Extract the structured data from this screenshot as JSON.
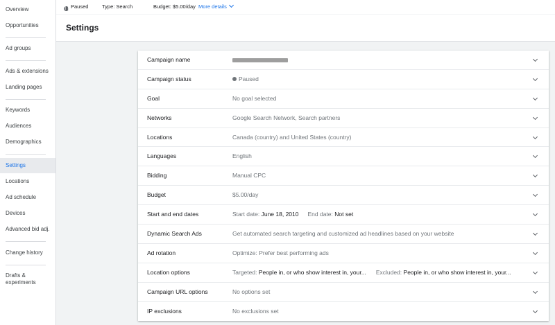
{
  "sidebar": {
    "items": [
      {
        "label": "Overview"
      },
      {
        "label": "Opportunities"
      },
      {
        "label": "Ad groups"
      },
      {
        "label": "Ads & extensions"
      },
      {
        "label": "Landing pages"
      },
      {
        "label": "Keywords"
      },
      {
        "label": "Audiences"
      },
      {
        "label": "Demographics"
      },
      {
        "label": "Settings"
      },
      {
        "label": "Locations"
      },
      {
        "label": "Ad schedule"
      },
      {
        "label": "Devices"
      },
      {
        "label": "Advanced bid adj."
      },
      {
        "label": "Change history"
      },
      {
        "label": "Drafts & experiments"
      }
    ],
    "active_item": "Settings"
  },
  "status_bar": {
    "status": "Paused",
    "type": "Type: Search",
    "budget": "Budget: $5.00/day",
    "more_details": "More details"
  },
  "header": {
    "title": "Settings"
  },
  "settings": {
    "rows": [
      {
        "label": "Campaign name",
        "value": ""
      },
      {
        "label": "Campaign status",
        "value": "Paused"
      },
      {
        "label": "Goal",
        "value": "No goal selected"
      },
      {
        "label": "Networks",
        "value": "Google Search Network, Search partners"
      },
      {
        "label": "Locations",
        "value": "Canada (country) and United States (country)"
      },
      {
        "label": "Languages",
        "value": "English"
      },
      {
        "label": "Bidding",
        "value": "Manual CPC"
      },
      {
        "label": "Budget",
        "value": "$5.00/day"
      },
      {
        "label": "Start and end dates",
        "start_prefix": "Start date:",
        "start_value": "June 18, 2010",
        "end_prefix": "End date:",
        "end_value": "Not set"
      },
      {
        "label": "Dynamic Search Ads",
        "value": "Get automated search targeting and customized ad headlines based on your website"
      },
      {
        "label": "Ad rotation",
        "value": "Optimize: Prefer best performing ads"
      },
      {
        "label": "Location options",
        "targeted_prefix": "Targeted:",
        "targeted_value": "People in, or who show interest in, your...",
        "excluded_prefix": "Excluded:",
        "excluded_value": "People in, or who show interest in, your..."
      },
      {
        "label": "Campaign URL options",
        "value": "No options set"
      },
      {
        "label": "IP exclusions",
        "value": "No exclusions set"
      }
    ]
  },
  "colors": {
    "accent": "#1a73e8",
    "background": "#f1f3f4",
    "card": "#ffffff",
    "muted_text": "#70757a",
    "text": "#202124"
  },
  "icons": {
    "status": "pause-circle-icon",
    "more_details": "chevron-down-icon",
    "row_expand": "chevron-down-icon"
  }
}
